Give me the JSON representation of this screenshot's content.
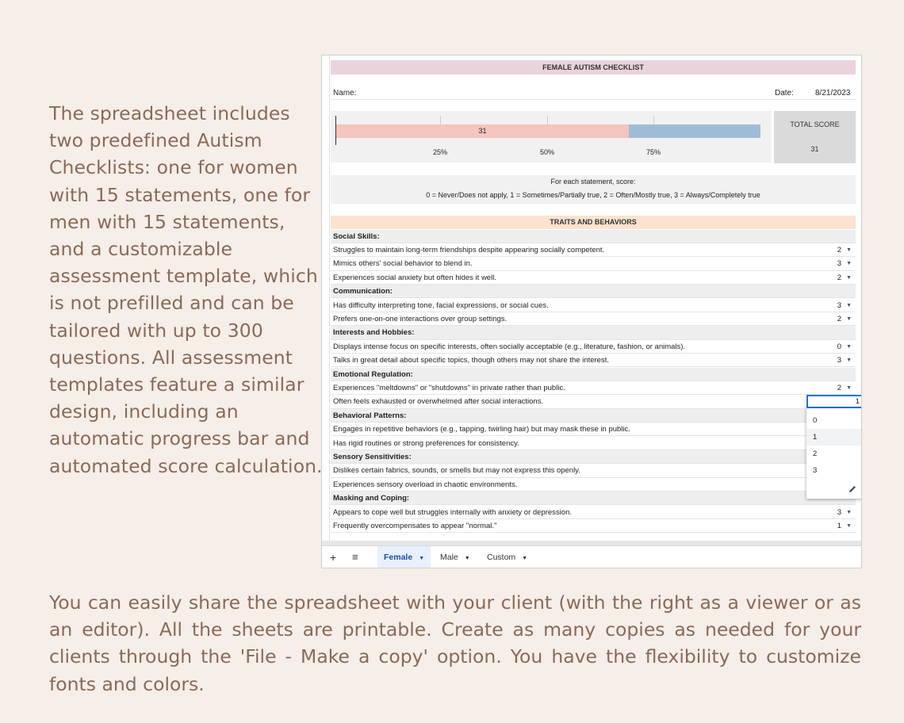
{
  "promo": {
    "left_text": "The spreadsheet includes two predefined Autism Checklists: one for women with 15 statements, one for men with 15 statements, and a customizable assessment template, which is not prefilled and can be tailored with up to 300 questions. All assessment templates feature a similar design, including an automatic progress bar and automated score calculation.",
    "bottom_text": "You can easily share the spreadsheet with your client (with the right as a viewer or as an editor). All the sheets are printable. Create as many copies as needed for your clients through the 'File - Make a copy' option. You have the flexibility to customize fonts and colors."
  },
  "sheet": {
    "title": "FEMALE AUTISM CHECKLIST",
    "name_label": "Name:",
    "date_label": "Date:",
    "date_value": "8/21/2023",
    "progress": {
      "value_label": "31",
      "filled_fraction": 0.69,
      "ticks": [
        "25%",
        "50%",
        "75%"
      ]
    },
    "total_score_label": "TOTAL SCORE",
    "total_score_value": "31",
    "instructions_line1": "For each statement, score:",
    "instructions_line2": "0 = Never/Does not apply, 1 = Sometimes/Partially true, 2 = Often/Mostly true, 3 = Always/Completely true",
    "traits_header": "TRAITS AND BEHAVIORS",
    "rows": [
      {
        "type": "category",
        "text": "Social Skills:"
      },
      {
        "type": "item",
        "text": "Struggles to maintain long-term friendships despite appearing socially competent.",
        "score": "2"
      },
      {
        "type": "item",
        "text": "Mimics others' social behavior to blend in.",
        "score": "3"
      },
      {
        "type": "item",
        "text": "Experiences social anxiety but often hides it well.",
        "score": "2"
      },
      {
        "type": "category",
        "text": "Communication:"
      },
      {
        "type": "item",
        "text": "Has difficulty interpreting tone, facial expressions, or social cues.",
        "score": "3"
      },
      {
        "type": "item",
        "text": "Prefers one-on-one interactions over group settings.",
        "score": "2"
      },
      {
        "type": "category",
        "text": "Interests and Hobbies:"
      },
      {
        "type": "item",
        "text": "Displays intense focus on specific interests, often socially acceptable (e.g., literature, fashion, or animals).",
        "score": "0"
      },
      {
        "type": "item",
        "text": "Talks in great detail about specific topics, though others may not share the interest.",
        "score": "3"
      },
      {
        "type": "category",
        "text": "Emotional Regulation:"
      },
      {
        "type": "item",
        "text": "Experiences \"meltdowns\" or \"shutdowns\" in private rather than public.",
        "score": "2"
      },
      {
        "type": "item",
        "text": "Often feels exhausted or overwhelmed after social interactions.",
        "score": ""
      },
      {
        "type": "category",
        "text": "Behavioral Patterns:"
      },
      {
        "type": "item",
        "text": "Engages in repetitive behaviors (e.g., tapping, twirling hair) but may mask these in public.",
        "score": ""
      },
      {
        "type": "item",
        "text": "Has rigid routines or strong preferences for consistency.",
        "score": ""
      },
      {
        "type": "category",
        "text": "Sensory Sensitivities:"
      },
      {
        "type": "item",
        "text": "Dislikes certain fabrics, sounds, or smells but may not express this openly.",
        "score": ""
      },
      {
        "type": "item",
        "text": "Experiences sensory overload in chaotic environments.",
        "score": ""
      },
      {
        "type": "category",
        "text": "Masking and Coping:"
      },
      {
        "type": "item",
        "text": "Appears to cope well but struggles internally with anxiety or depression.",
        "score": "3"
      },
      {
        "type": "item",
        "text": "Frequently overcompensates to appear \"normal.\"",
        "score": "1"
      }
    ],
    "active_cell_value": "1",
    "dropdown_options": [
      "0",
      "1",
      "2",
      "3"
    ],
    "dropdown_highlighted": "1",
    "tabs": [
      {
        "label": "Female",
        "active": true
      },
      {
        "label": "Male",
        "active": false
      },
      {
        "label": "Custom",
        "active": false
      }
    ],
    "icons": {
      "add_sheet": "plus-icon",
      "all_sheets": "menu-icon",
      "edit": "pencil-icon",
      "dropdown_caret": "caret-down-icon"
    },
    "colors": {
      "title_bg": "#ead3dd",
      "traits_bg": "#fbe3cf",
      "progress_fill": "#f4c4be",
      "progress_rest": "#9fbcd6",
      "selection": "#1a73e8"
    }
  }
}
